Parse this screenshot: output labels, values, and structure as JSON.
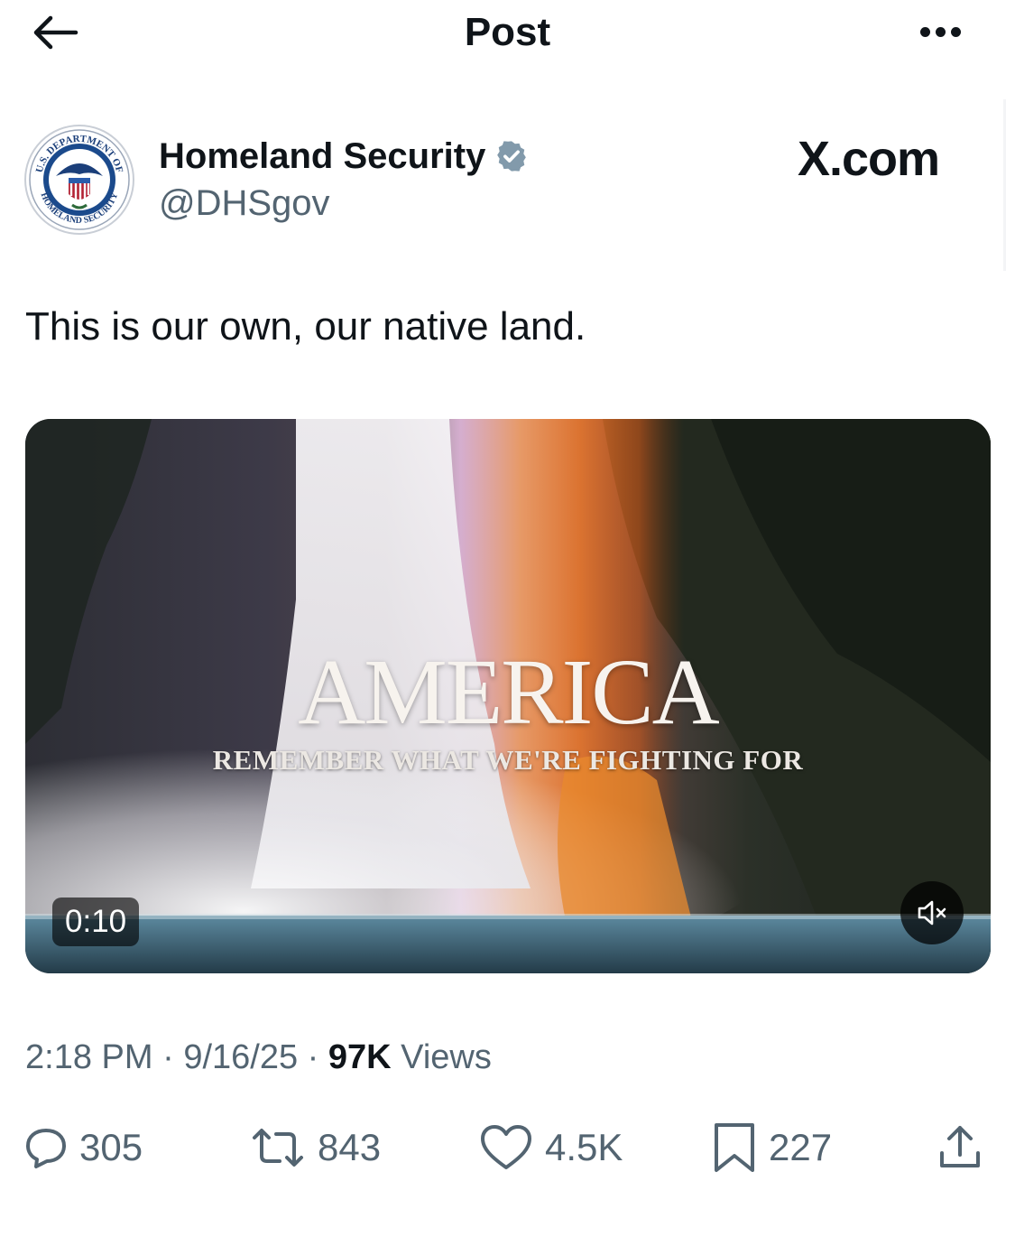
{
  "header": {
    "title": "Post",
    "back_icon": "arrow-left-icon",
    "more_icon": "more-horizontal-icon"
  },
  "author": {
    "name": "Homeland Security",
    "handle": "@DHSgov",
    "verified_icon": "verified-badge-icon",
    "verified_color": "#829aab",
    "avatar": {
      "seal_top_text": "U.S. DEPARTMENT OF",
      "seal_bottom_text": "HOMELAND SECURITY"
    }
  },
  "source_label": "X.com",
  "post": {
    "text": "This is our own, our native land."
  },
  "media": {
    "title": "AMERICA",
    "subtitle": "REMEMBER WHAT WE'RE FIGHTING FOR",
    "duration": "0:10",
    "mute_icon": "speaker-muted-icon"
  },
  "meta": {
    "time": "2:18 PM",
    "date": "9/16/25",
    "views_count": "97K",
    "views_label": "Views"
  },
  "actions": {
    "replies": "305",
    "reposts": "843",
    "likes": "4.5K",
    "bookmarks": "227"
  },
  "colors": {
    "text_primary": "#0f1419",
    "text_secondary": "#536471",
    "background": "#ffffff"
  }
}
